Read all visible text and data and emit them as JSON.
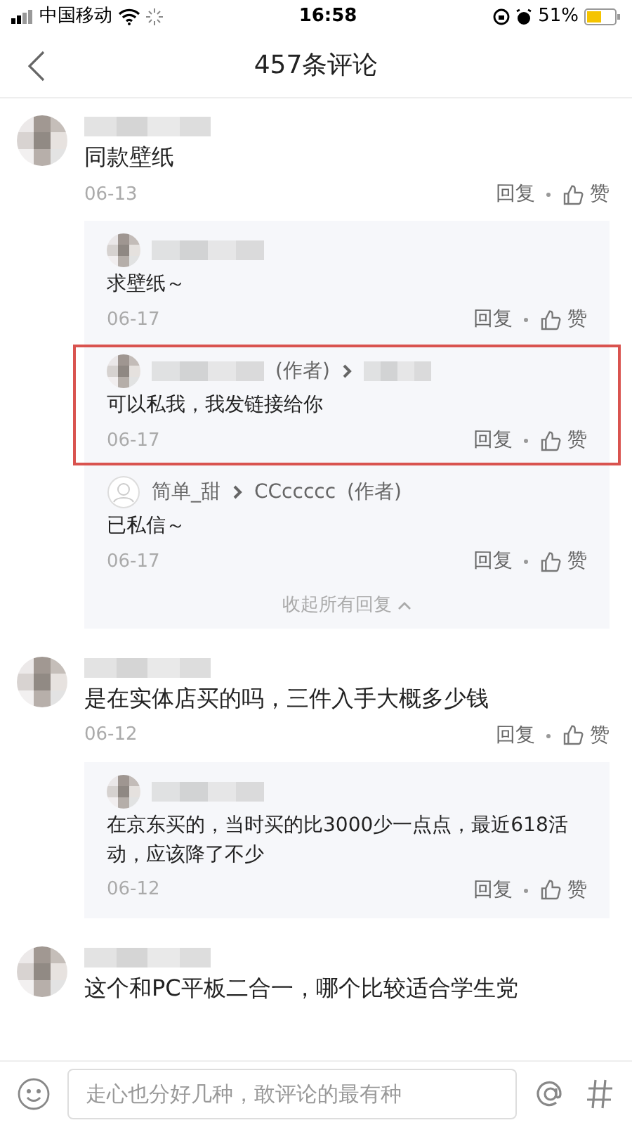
{
  "status_bar": {
    "carrier": "中国移动",
    "time": "16:58",
    "battery": "51%"
  },
  "nav": {
    "title": "457条评论"
  },
  "comments": [
    {
      "default_avatar": false,
      "author_blurred": true,
      "text": "同款壁纸",
      "date": "06-13",
      "reply_label": "回复",
      "like_label": "赞",
      "replies": [
        {
          "default_avatar": false,
          "author_blurred": true,
          "text": "求壁纸～",
          "date": "06-17",
          "reply_label": "回复",
          "like_label": "赞",
          "highlighted": false
        },
        {
          "default_avatar": false,
          "author_blurred": true,
          "author_tag": "(作者)",
          "reply_to": {
            "blurred": true
          },
          "text": "可以私我，我发链接给你",
          "date": "06-17",
          "reply_label": "回复",
          "like_label": "赞",
          "highlighted": true
        },
        {
          "default_avatar": true,
          "author": "简单_甜",
          "reply_to": {
            "name": "CCccccc",
            "tag": "(作者)"
          },
          "text": "已私信～",
          "date": "06-17",
          "reply_label": "回复",
          "like_label": "赞",
          "highlighted": false
        }
      ],
      "collapse_label": "收起所有回复"
    },
    {
      "default_avatar": false,
      "author_blurred": true,
      "text": "是在实体店买的吗，三件入手大概多少钱",
      "date": "06-12",
      "reply_label": "回复",
      "like_label": "赞",
      "replies": [
        {
          "default_avatar": false,
          "author_blurred": true,
          "text": "在京东买的，当时买的比3000少一点点，最近618活动，应该降了不少",
          "date": "06-12",
          "reply_label": "回复",
          "like_label": "赞",
          "highlighted": false
        }
      ]
    },
    {
      "default_avatar": false,
      "author_blurred": true,
      "text": "这个和PC平板二合一，哪个比较适合学生党"
    }
  ],
  "composer": {
    "placeholder": "走心也分好几种，敢评论的最有种"
  }
}
